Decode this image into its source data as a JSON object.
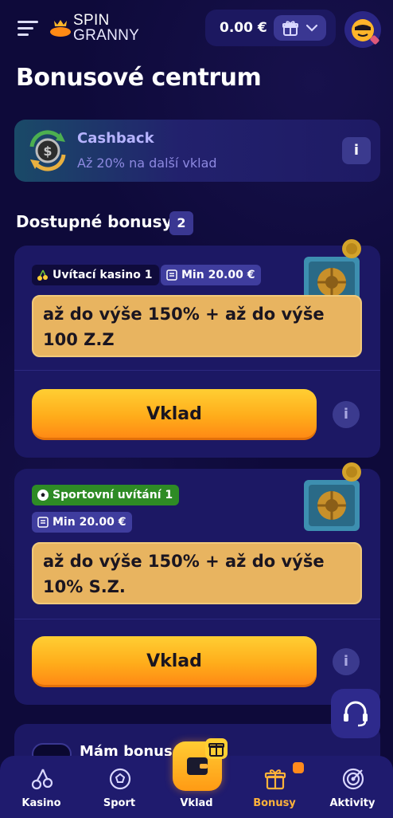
{
  "header": {
    "logo_line1": "SPIN",
    "logo_line2": "GRANNY",
    "balance": "0.00 €"
  },
  "page_title": "Bonusové centrum",
  "cashback": {
    "title": "Cashback",
    "subtitle": "Až 20% na další vklad",
    "info_label": "i"
  },
  "available": {
    "title": "Dostupné bonusy",
    "count": "2"
  },
  "bonuses": [
    {
      "tag": "Uvítací kasino 1",
      "min": "Min 20.00 €",
      "offer": "až do výše 150% + až do výše 100 Z.Z",
      "cta": "Vklad",
      "info_label": "i"
    },
    {
      "tag": "Sportovní uvítání 1",
      "min": "Min 20.00 €",
      "offer": "až do výše 150% + až do výše 10% S.Z.",
      "cta": "Vklad",
      "info_label": "i"
    }
  ],
  "promo_toggle_label": "Mám bonusov",
  "nav": {
    "casino": "Kasino",
    "sport": "Sport",
    "deposit": "Vklad",
    "bonuses": "Bonusy",
    "activities": "Aktivity"
  },
  "colors": {
    "background": "#0e0a3a",
    "card": "#1c1864",
    "accent": "#ffab1a",
    "offer_bg": "#e8b460",
    "active_nav": "#ffb23a"
  }
}
